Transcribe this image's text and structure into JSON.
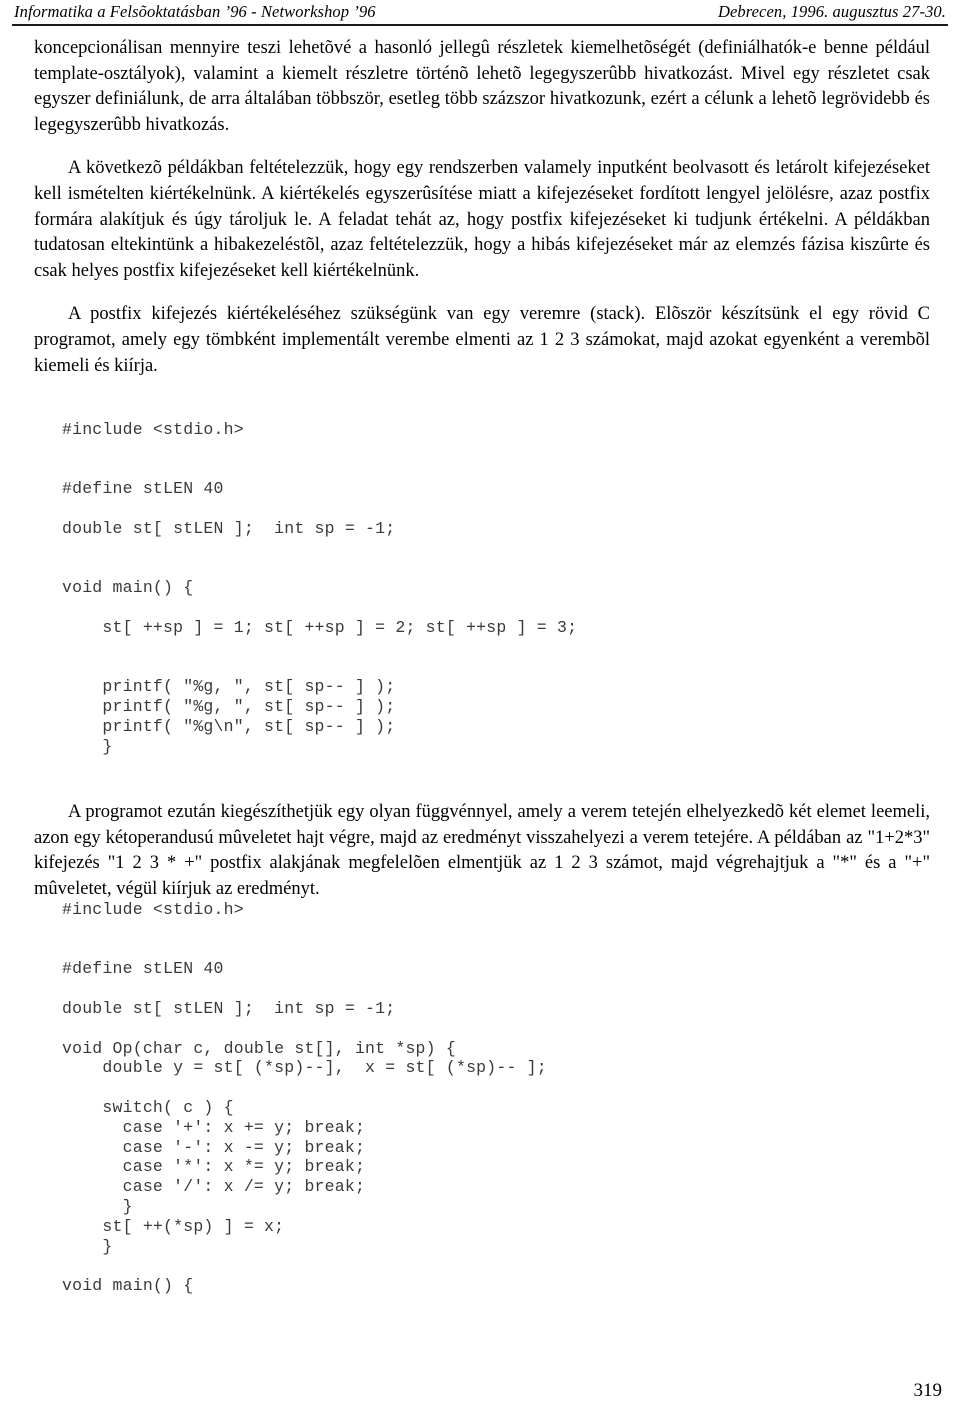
{
  "header": {
    "left": "Informatika a Felsõoktatásban ’96 - Networkshop ’96",
    "right": "Debrecen, 1996. augusztus 27-30."
  },
  "body": {
    "paragraph_1": "koncepcionálisan mennyire teszi lehetõvé a hasonló jellegû részletek kiemelhetõségét (definiálhatók-e benne például template-osztályok), valamint a kiemelt részletre történõ lehetõ legegyszerûbb hivatkozást. Mivel egy részletet csak egyszer definiálunk, de arra általában többször, esetleg több százszor hivatkozunk, ezért a célunk a lehetõ legrövidebb és legegyszerûbb hivatkozás.",
    "paragraph_2": "A következõ példákban feltételezzük, hogy egy rendszerben valamely inputként beolvasott és letárolt kifejezéseket kell ismételten kiértékelnünk. A kiértékelés egyszerûsítése miatt a kifejezéseket fordított lengyel jelölésre, azaz postfix formára alakítjuk és úgy tároljuk le. A feladat tehát az, hogy postfix kifejezéseket ki tudjunk értékelni. A példákban tudatosan eltekintünk a hibakezeléstõl, azaz feltételezzük, hogy a hibás kifejezéseket már az elemzés fázisa kiszûrte és csak helyes postfix kifejezéseket kell kiértékelnünk.",
    "paragraph_3": "A postfix kifejezés kiértékeléséhez szükségünk van egy veremre (stack). Elõször készítsünk el egy rövid C programot, amely egy tömbként implementált verembe elmenti az 1 2 3 számokat, majd azokat egyenként a verembõl kiemeli és kiírja.",
    "paragraph_4": "A programot ezután kiegészíthetjük egy olyan függvénnyel, amely a verem tetején elhelyezkedõ két elemet leemeli, azon egy kétoperandusú mûveletet hajt végre, majd az eredményt visszahelyezi a verem tetejére. A példában az  \"1+2*3\" kifejezés \"1 2 3 * +\" postfix alakjának megfelelõen elmentjük az 1 2 3 számot, majd végrehajtjuk a \"*\" és a \"+\" mûveletet, végül kiírjuk az eredményt."
  },
  "code_block_1": "#include <stdio.h>\n\n\n#define stLEN 40\n\ndouble st[ stLEN ];  int sp = -1;\n\n\nvoid main() {\n\n    st[ ++sp ] = 1; st[ ++sp ] = 2; st[ ++sp ] = 3;\n\n\n    printf( \"%g, \", st[ sp-- ] );\n    printf( \"%g, \", st[ sp-- ] );\n    printf( \"%g\\n\", st[ sp-- ] );\n    }",
  "code_block_2": "#include <stdio.h>\n\n\n#define stLEN 40\n\ndouble st[ stLEN ];  int sp = -1;\n\nvoid Op(char c, double st[], int *sp) {\n    double y = st[ (*sp)--],  x = st[ (*sp)-- ];\n\n    switch( c ) {\n      case '+': x += y; break;\n      case '-': x -= y; break;\n      case '*': x *= y; break;\n      case '/': x /= y; break;\n      }\n    st[ ++(*sp) ] = x;\n    }\n\nvoid main() {",
  "folio": {
    "page_number": "319"
  }
}
